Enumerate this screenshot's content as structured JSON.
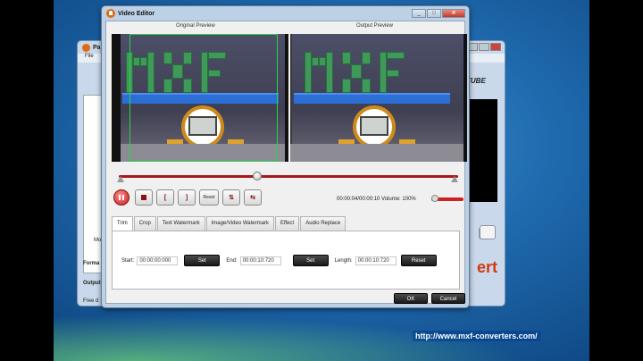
{
  "background_app": {
    "title": "Pa",
    "menu_file": "File",
    "brand_tail": "TUBE",
    "convert_label": "ert",
    "format_label": "Forma",
    "output_label": "Output",
    "free_label": "Free d",
    "move_label": "Mo"
  },
  "editor": {
    "title": "Video Editor",
    "original_preview": "Original Preview",
    "output_preview": "Output Preview",
    "time_volume": "00:00:04/00:00:10  Volume: 100%",
    "controls": {
      "reset": "Reset",
      "start_mark": "[",
      "end_mark": "]"
    },
    "tabs": [
      "Trim",
      "Crop",
      "Text Watermark",
      "Image/Video Watermark",
      "Effect",
      "Audio Replace"
    ],
    "trim": {
      "start_label": "Start:",
      "start_value": "00:00:00:000",
      "set1": "Set",
      "end_label": "End:",
      "end_value": "00:00:10:720",
      "set2": "Set",
      "length_label": "Length:",
      "length_value": "00:00:10:720",
      "reset": "Reset"
    },
    "ok": "OK",
    "cancel": "Cancel"
  },
  "desktop": {
    "url": "http://www.mxf-converters.com/"
  },
  "colors": {
    "accent_red": "#a31a1a",
    "crop_green": "#2bd14a",
    "brand_orange": "#e36b0e"
  }
}
